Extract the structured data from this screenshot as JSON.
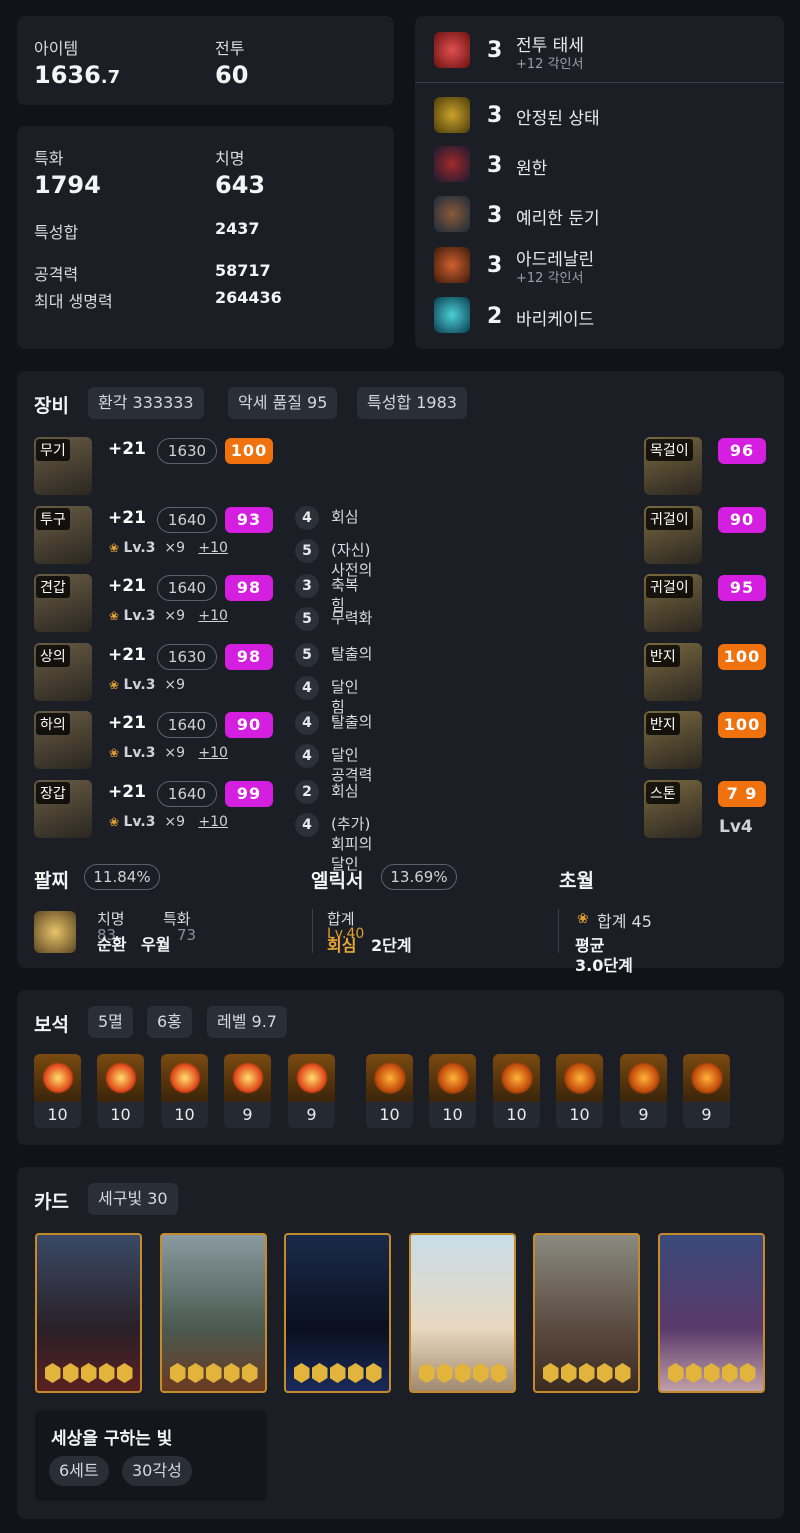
{
  "summary": {
    "item_label": "아이템",
    "item_value": "1636",
    "item_decimal": ".7",
    "combat_label": "전투",
    "combat_value": "60"
  },
  "stats": {
    "spec_label": "특화",
    "spec_value": "1794",
    "crit_label": "치명",
    "crit_value": "643",
    "sum_label": "특성합",
    "sum_value": "2437",
    "atk_label": "공격력",
    "atk_value": "58717",
    "hp_label": "최대 생명력",
    "hp_value": "264436"
  },
  "engravings": [
    {
      "level": "3",
      "name": "전투 태세",
      "sub": "+12 각인서",
      "icon": "combat-stance-icon"
    },
    {
      "level": "3",
      "name": "안정된 상태",
      "icon": "stable-state-icon"
    },
    {
      "level": "3",
      "name": "원한",
      "icon": "grudge-icon"
    },
    {
      "level": "3",
      "name": "예리한 둔기",
      "icon": "keen-blunt-icon"
    },
    {
      "level": "3",
      "name": "아드레날린",
      "sub": "+12 각인서",
      "icon": "adrenaline-icon"
    },
    {
      "level": "2",
      "name": "바리케이드",
      "icon": "barricade-icon"
    }
  ],
  "equipment": {
    "title": "장비",
    "pills": [
      "환각 333333",
      "악세 품질 95",
      "특성합 1983"
    ],
    "gear": [
      {
        "slot": "무기",
        "plus": "+21",
        "ilvl": "1630",
        "quality": "100",
        "color": "#f0720e"
      },
      {
        "slot": "투구",
        "plus": "+21",
        "ilvl": "1640",
        "quality": "93",
        "color": "#d51fe0",
        "lv": "Lv.3",
        "mult": "×9",
        "bonus": "+10",
        "effects": [
          {
            "n": "4",
            "t": "회심"
          },
          {
            "n": "5",
            "t": "(자신)\n사전의"
          }
        ]
      },
      {
        "slot": "견갑",
        "plus": "+21",
        "ilvl": "1640",
        "quality": "98",
        "color": "#d51fe0",
        "lv": "Lv.3",
        "mult": "×9",
        "bonus": "+10",
        "effects": [
          {
            "n": "3",
            "t": "축복\n힘"
          },
          {
            "n": "5",
            "t": "무력화"
          }
        ]
      },
      {
        "slot": "상의",
        "plus": "+21",
        "ilvl": "1630",
        "quality": "98",
        "color": "#d51fe0",
        "lv": "Lv.3",
        "mult": "×9",
        "bonus": "",
        "effects": [
          {
            "n": "5",
            "t": "탈출의"
          },
          {
            "n": "4",
            "t": "달인\n힘"
          }
        ]
      },
      {
        "slot": "하의",
        "plus": "+21",
        "ilvl": "1640",
        "quality": "90",
        "color": "#d51fe0",
        "lv": "Lv.3",
        "mult": "×9",
        "bonus": "+10",
        "effects": [
          {
            "n": "4",
            "t": "탈출의"
          },
          {
            "n": "4",
            "t": "달인\n공격력"
          }
        ]
      },
      {
        "slot": "장갑",
        "plus": "+21",
        "ilvl": "1640",
        "quality": "99",
        "color": "#d51fe0",
        "lv": "Lv.3",
        "mult": "×9",
        "bonus": "+10",
        "effects": [
          {
            "n": "2",
            "t": "회심"
          },
          {
            "n": "4",
            "t": "(추가)\n회피의\n달인"
          }
        ]
      }
    ],
    "accessories": [
      {
        "slot": "목걸이",
        "quality": "96",
        "color": "#d51fe0"
      },
      {
        "slot": "귀걸이",
        "quality": "90",
        "color": "#d51fe0"
      },
      {
        "slot": "귀걸이",
        "quality": "95",
        "color": "#d51fe0"
      },
      {
        "slot": "반지",
        "quality": "100",
        "color": "#f0720e"
      },
      {
        "slot": "반지",
        "quality": "100",
        "color": "#f0720e"
      },
      {
        "slot": "스톤",
        "quality": "7 9",
        "color": "#f0720e",
        "extra": "Lv4"
      }
    ]
  },
  "bracelet": {
    "title": "팔찌",
    "pct": "11.84%",
    "stat1_label": "치명",
    "stat1_val": "83",
    "stat2_label": "특화",
    "stat2_val": "73",
    "eff1": "순환",
    "eff2": "우월"
  },
  "elixir": {
    "title": "엘릭서",
    "pct": "13.69%",
    "sum_label": "합계",
    "lv": "Lv.40",
    "effect": "회심",
    "stage": "2단계"
  },
  "transcend": {
    "title": "초월",
    "sum": "합계 45",
    "avg": "평균",
    "avg_val": "3.0단계"
  },
  "gems": {
    "title": "보석",
    "pills": [
      "5멸",
      "6홍",
      "레벨 9.7"
    ],
    "levels": [
      "10",
      "10",
      "10",
      "9",
      "9",
      "10",
      "10",
      "10",
      "10",
      "9",
      "9"
    ]
  },
  "cards": {
    "title": "카드",
    "pill": "세구빛 30",
    "set_name": "세상을 구하는 빛",
    "set_tags": [
      "6세트",
      "30각성"
    ]
  }
}
